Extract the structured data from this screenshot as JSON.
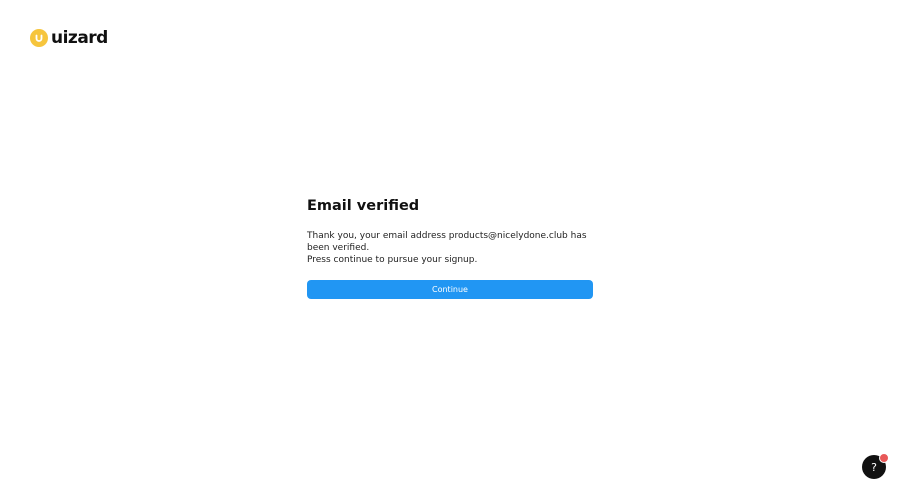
{
  "brand": {
    "name": "uizard",
    "accent_color": "#f6c53d"
  },
  "verification": {
    "title": "Email verified",
    "message_line1": "Thank you, your email address products@nicelydone.club has been verified.",
    "message_line2": "Press continue to pursue your signup.",
    "continue_label": "Continue",
    "button_color": "#2196f3"
  },
  "help": {
    "icon": "question-mark-icon",
    "label": "?",
    "badge_color": "#e85858"
  }
}
